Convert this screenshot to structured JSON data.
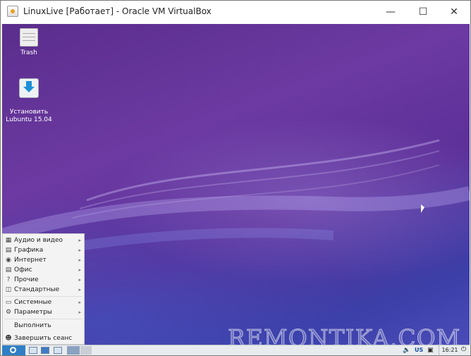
{
  "window": {
    "title": "LinuxLive [Работает] - Oracle VM VirtualBox",
    "minimize_icon": "minimize-icon",
    "maximize_icon": "maximize-icon",
    "close_icon": "close-icon"
  },
  "desktop": {
    "icons": [
      {
        "label": "Trash",
        "icon": "trash-icon"
      },
      {
        "label": "Установить\nLubuntu 15.04",
        "icon": "install-icon"
      }
    ],
    "watermark": "REMONTIKA.COM"
  },
  "menu": {
    "items": [
      {
        "label": "Аудио и видео",
        "icon": "multimedia-icon"
      },
      {
        "label": "Графика",
        "icon": "graphics-icon"
      },
      {
        "label": "Интернет",
        "icon": "internet-icon"
      },
      {
        "label": "Офис",
        "icon": "office-icon"
      },
      {
        "label": "Прочие",
        "icon": "other-icon"
      },
      {
        "label": "Стандартные",
        "icon": "accessories-icon"
      },
      {
        "label": "Системные",
        "icon": "system-icon"
      },
      {
        "label": "Параметры",
        "icon": "settings-icon"
      },
      {
        "label": "Выполнить",
        "icon": ""
      },
      {
        "label": "Завершить сеанс",
        "icon": "logout-icon"
      }
    ]
  },
  "taskbar": {
    "keyboard_layout": "US",
    "clock": "16:21"
  }
}
